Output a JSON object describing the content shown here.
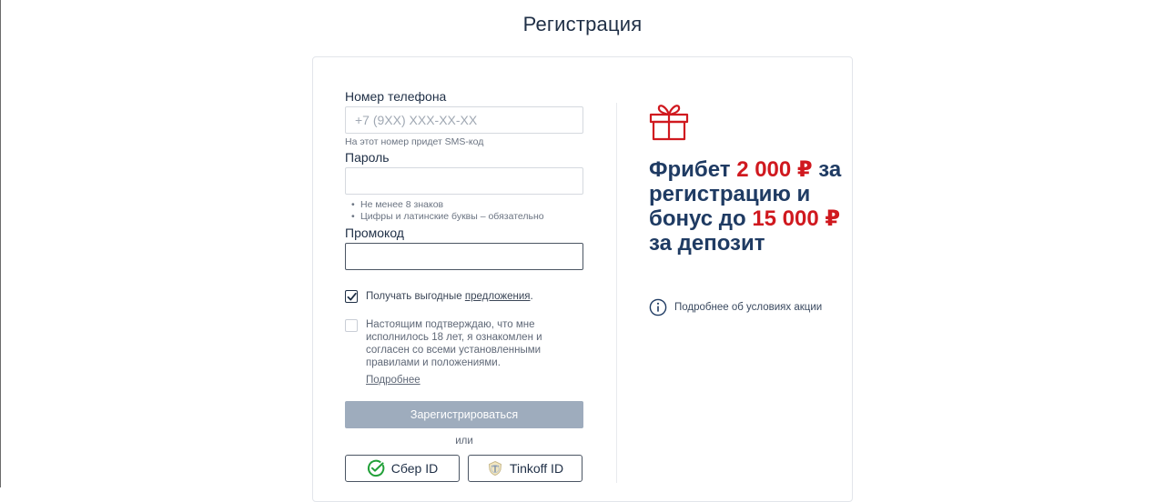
{
  "page": {
    "title": "Регистрация"
  },
  "form": {
    "phone": {
      "label": "Номер телефона",
      "placeholder": "+7 (9XX) XXX-XX-XX",
      "hint": "На этот номер придет SMS-код"
    },
    "password": {
      "label": "Пароль",
      "rules": [
        "Не менее 8 знаков",
        "Цифры и латинские буквы – обязательно"
      ]
    },
    "promo_code": {
      "label": "Промокод"
    },
    "offers_checkbox": {
      "checked": true,
      "text_before": "Получать выгодные ",
      "link_text": "предложения",
      "text_after": "."
    },
    "consent_checkbox": {
      "checked": false,
      "text": "Настоящим подтверждаю, что мне исполнилось 18 лет, я ознакомлен и согласен со всеми установленными правилами и положениями.",
      "more_link": "Подробнее"
    },
    "submit_label": "Зарегистрироваться",
    "or_label": "или",
    "sber_label": "Сбер ID",
    "tinkoff_label": "Tinkoff ID"
  },
  "promo": {
    "headline_1": "Фрибет ",
    "headline_amount_1": "2 000 ₽",
    "headline_2": " за регистрацию и бонус до ",
    "headline_amount_2": "15 000 ₽",
    "headline_3": " за депозит",
    "details_link": "Подробнее об условиях акции"
  },
  "colors": {
    "accent_red": "#d0191f",
    "navy": "#1f3b63",
    "button_disabled": "#9eacbd",
    "sber_green": "#21a038"
  },
  "icons": {
    "gift": "gift-icon",
    "info": "info-icon",
    "check": "checkmark-icon",
    "sber": "sber-logo-icon",
    "tinkoff": "tinkoff-logo-icon"
  }
}
